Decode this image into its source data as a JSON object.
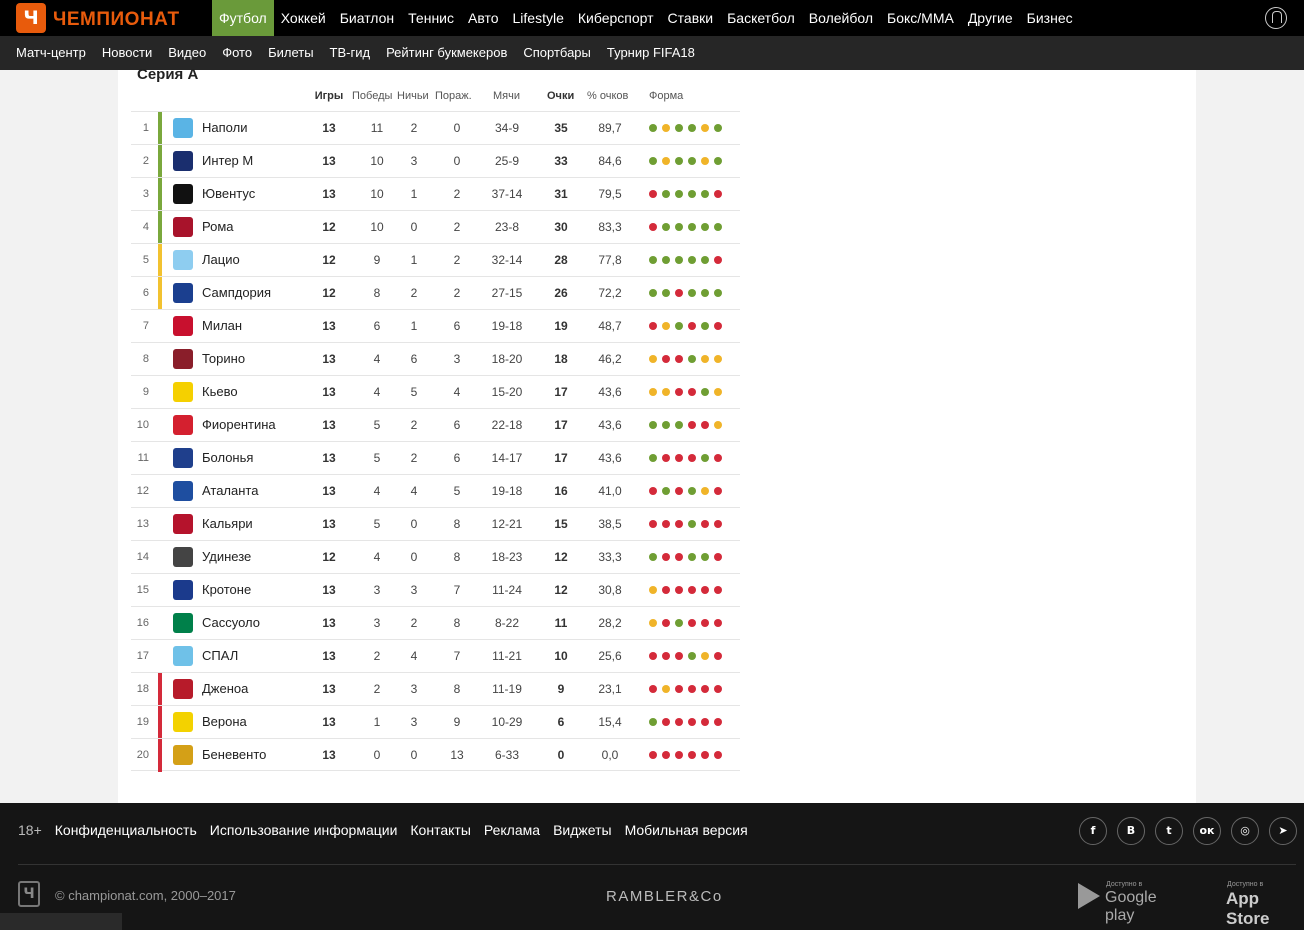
{
  "header": {
    "logo_letter": "Ч",
    "logo_text": "ЧЕМПИОНАТ",
    "nav": [
      "Футбол",
      "Хоккей",
      "Биатлон",
      "Теннис",
      "Авто",
      "Lifestyle",
      "Киберспорт",
      "Ставки",
      "Баскетбол",
      "Волейбол",
      "Бокс/ММА",
      "Другие",
      "Бизнес"
    ],
    "active_nav": "Футбол",
    "subnav": [
      "Матч-центр",
      "Новости",
      "Видео",
      "Фото",
      "Билеты",
      "ТВ-гид",
      "Рейтинг букмекеров",
      "Спортбары",
      "Турнир FIFA18"
    ]
  },
  "colors": {
    "brand": "#e85b0c",
    "active_nav": "#6a9a3a",
    "champions": "#7aa83c",
    "europa": "#f2c230",
    "relegation": "#d42a3a",
    "form_win": "#6f9e33",
    "form_draw": "#f0b429",
    "form_loss": "#d42a3a"
  },
  "standings": {
    "title": "Серия А",
    "columns": {
      "games": "Игры",
      "wins": "Победы",
      "draws": "Ничьи",
      "losses": "Пораж.",
      "goals": "Мячи",
      "points": "Очки",
      "pct": "% очков",
      "form": "Форма"
    },
    "rows": [
      {
        "pos": "1",
        "team": "Наполи",
        "games": "13",
        "wins": "11",
        "draws": "2",
        "losses": "0",
        "goals": "34-9",
        "points": "35",
        "pct": "89,7",
        "zone": "champions",
        "crest": "#5ab4e5",
        "form": [
          "W",
          "D",
          "W",
          "W",
          "D",
          "W"
        ]
      },
      {
        "pos": "2",
        "team": "Интер М",
        "games": "13",
        "wins": "10",
        "draws": "3",
        "losses": "0",
        "goals": "25-9",
        "points": "33",
        "pct": "84,6",
        "zone": "champions",
        "crest": "#1a2e6e",
        "form": [
          "W",
          "D",
          "W",
          "W",
          "D",
          "W"
        ]
      },
      {
        "pos": "3",
        "team": "Ювентус",
        "games": "13",
        "wins": "10",
        "draws": "1",
        "losses": "2",
        "goals": "37-14",
        "points": "31",
        "pct": "79,5",
        "zone": "champions",
        "crest": "#111111",
        "form": [
          "L",
          "W",
          "W",
          "W",
          "W",
          "L"
        ]
      },
      {
        "pos": "4",
        "team": "Рома",
        "games": "12",
        "wins": "10",
        "draws": "0",
        "losses": "2",
        "goals": "23-8",
        "points": "30",
        "pct": "83,3",
        "zone": "champions",
        "crest": "#a8132b",
        "form": [
          "L",
          "W",
          "W",
          "W",
          "W",
          "W"
        ]
      },
      {
        "pos": "5",
        "team": "Лацио",
        "games": "12",
        "wins": "9",
        "draws": "1",
        "losses": "2",
        "goals": "32-14",
        "points": "28",
        "pct": "77,8",
        "zone": "europa",
        "crest": "#8ecdf0",
        "form": [
          "W",
          "W",
          "W",
          "W",
          "W",
          "L"
        ]
      },
      {
        "pos": "6",
        "team": "Сампдория",
        "games": "12",
        "wins": "8",
        "draws": "2",
        "losses": "2",
        "goals": "27-15",
        "points": "26",
        "pct": "72,2",
        "zone": "europa",
        "crest": "#1b3f8f",
        "form": [
          "W",
          "W",
          "L",
          "W",
          "W",
          "W"
        ]
      },
      {
        "pos": "7",
        "team": "Милан",
        "games": "13",
        "wins": "6",
        "draws": "1",
        "losses": "6",
        "goals": "19-18",
        "points": "19",
        "pct": "48,7",
        "zone": "",
        "crest": "#c8102e",
        "form": [
          "L",
          "D",
          "W",
          "L",
          "W",
          "L"
        ]
      },
      {
        "pos": "8",
        "team": "Торино",
        "games": "13",
        "wins": "4",
        "draws": "6",
        "losses": "3",
        "goals": "18-20",
        "points": "18",
        "pct": "46,2",
        "zone": "",
        "crest": "#8a1e2a",
        "form": [
          "D",
          "L",
          "L",
          "W",
          "D",
          "D"
        ]
      },
      {
        "pos": "9",
        "team": "Кьево",
        "games": "13",
        "wins": "4",
        "draws": "5",
        "losses": "4",
        "goals": "15-20",
        "points": "17",
        "pct": "43,6",
        "zone": "",
        "crest": "#f5d000",
        "form": [
          "D",
          "D",
          "L",
          "L",
          "W",
          "D"
        ]
      },
      {
        "pos": "10",
        "team": "Фиорентина",
        "games": "13",
        "wins": "5",
        "draws": "2",
        "losses": "6",
        "goals": "22-18",
        "points": "17",
        "pct": "43,6",
        "zone": "",
        "crest": "#d4202f",
        "form": [
          "W",
          "W",
          "W",
          "L",
          "L",
          "D"
        ]
      },
      {
        "pos": "11",
        "team": "Болонья",
        "games": "13",
        "wins": "5",
        "draws": "2",
        "losses": "6",
        "goals": "14-17",
        "points": "17",
        "pct": "43,6",
        "zone": "",
        "crest": "#1f3f8c",
        "form": [
          "W",
          "L",
          "L",
          "L",
          "W",
          "L"
        ]
      },
      {
        "pos": "12",
        "team": "Аталанта",
        "games": "13",
        "wins": "4",
        "draws": "4",
        "losses": "5",
        "goals": "19-18",
        "points": "16",
        "pct": "41,0",
        "zone": "",
        "crest": "#1e4ea0",
        "form": [
          "L",
          "W",
          "L",
          "W",
          "D",
          "L"
        ]
      },
      {
        "pos": "13",
        "team": "Кальяри",
        "games": "13",
        "wins": "5",
        "draws": "0",
        "losses": "8",
        "goals": "12-21",
        "points": "15",
        "pct": "38,5",
        "zone": "",
        "crest": "#b5132c",
        "form": [
          "L",
          "L",
          "L",
          "W",
          "L",
          "L"
        ]
      },
      {
        "pos": "14",
        "team": "Удинезе",
        "games": "12",
        "wins": "4",
        "draws": "0",
        "losses": "8",
        "goals": "18-23",
        "points": "12",
        "pct": "33,3",
        "zone": "",
        "crest": "#444444",
        "form": [
          "W",
          "L",
          "L",
          "W",
          "W",
          "L"
        ]
      },
      {
        "pos": "15",
        "team": "Кротоне",
        "games": "13",
        "wins": "3",
        "draws": "3",
        "losses": "7",
        "goals": "11-24",
        "points": "12",
        "pct": "30,8",
        "zone": "",
        "crest": "#1b3a8c",
        "form": [
          "D",
          "L",
          "L",
          "L",
          "L",
          "L"
        ]
      },
      {
        "pos": "16",
        "team": "Сассуоло",
        "games": "13",
        "wins": "3",
        "draws": "2",
        "losses": "8",
        "goals": "8-22",
        "points": "11",
        "pct": "28,2",
        "zone": "",
        "crest": "#00804a",
        "form": [
          "D",
          "L",
          "W",
          "L",
          "L",
          "L"
        ]
      },
      {
        "pos": "17",
        "team": "СПАЛ",
        "games": "13",
        "wins": "2",
        "draws": "4",
        "losses": "7",
        "goals": "11-21",
        "points": "10",
        "pct": "25,6",
        "zone": "",
        "crest": "#6fc1e8",
        "form": [
          "L",
          "L",
          "L",
          "W",
          "D",
          "L"
        ]
      },
      {
        "pos": "18",
        "team": "Дженоа",
        "games": "13",
        "wins": "2",
        "draws": "3",
        "losses": "8",
        "goals": "11-19",
        "points": "9",
        "pct": "23,1",
        "zone": "relegation",
        "crest": "#b71b2a",
        "form": [
          "L",
          "D",
          "L",
          "L",
          "L",
          "L"
        ]
      },
      {
        "pos": "19",
        "team": "Верона",
        "games": "13",
        "wins": "1",
        "draws": "3",
        "losses": "9",
        "goals": "10-29",
        "points": "6",
        "pct": "15,4",
        "zone": "relegation",
        "crest": "#f3d200",
        "form": [
          "W",
          "L",
          "L",
          "L",
          "L",
          "L"
        ]
      },
      {
        "pos": "20",
        "team": "Беневенто",
        "games": "13",
        "wins": "0",
        "draws": "0",
        "losses": "13",
        "goals": "6-33",
        "points": "0",
        "pct": "0,0",
        "zone": "relegation",
        "crest": "#d4a017",
        "form": [
          "L",
          "L",
          "L",
          "L",
          "L",
          "L"
        ]
      }
    ]
  },
  "footer": {
    "age": "18+",
    "links": [
      "Конфиденциальность",
      "Использование информации",
      "Контакты",
      "Реклама",
      "Виджеты",
      "Мобильная версия"
    ],
    "socials": [
      {
        "name": "facebook-icon",
        "glyph": "f"
      },
      {
        "name": "vk-icon",
        "glyph": "В"
      },
      {
        "name": "twitter-icon",
        "glyph": "t"
      },
      {
        "name": "odnoklassniki-icon",
        "glyph": "ок"
      },
      {
        "name": "instagram-icon",
        "glyph": "◎"
      },
      {
        "name": "telegram-icon",
        "glyph": "➤"
      }
    ],
    "copyright": "© championat.com, 2000–2017",
    "rambler": "RAMBLER&Co",
    "gplay_small": "Доступно в",
    "gplay_big": "Google play",
    "appstore_small": "Доступно в",
    "appstore_big": "App Store"
  }
}
